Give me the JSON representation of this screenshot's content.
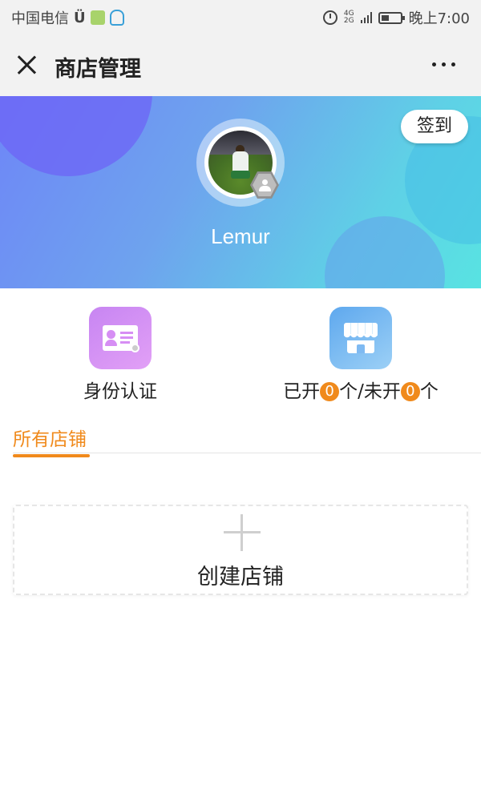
{
  "status_bar": {
    "carrier": "中国电信",
    "network_top": "4G",
    "network_bottom": "2G",
    "time": "晚上7:00"
  },
  "nav": {
    "title": "商店管理",
    "close_icon": "close-icon",
    "more_icon": "more-icon"
  },
  "header": {
    "checkin_label": "签到",
    "username": "Lemur"
  },
  "actions": {
    "identity_label": "身份认证",
    "shops_prefix": "已开",
    "open_count": "0",
    "shops_middle": "个/未开",
    "closed_count": "0",
    "shops_suffix": "个"
  },
  "tabs": {
    "all_shops": "所有店铺"
  },
  "create_shop": {
    "label": "创建店铺"
  },
  "colors": {
    "accent": "#f08a1c",
    "header_start": "#6e86f7",
    "header_end": "#58e3e2"
  }
}
